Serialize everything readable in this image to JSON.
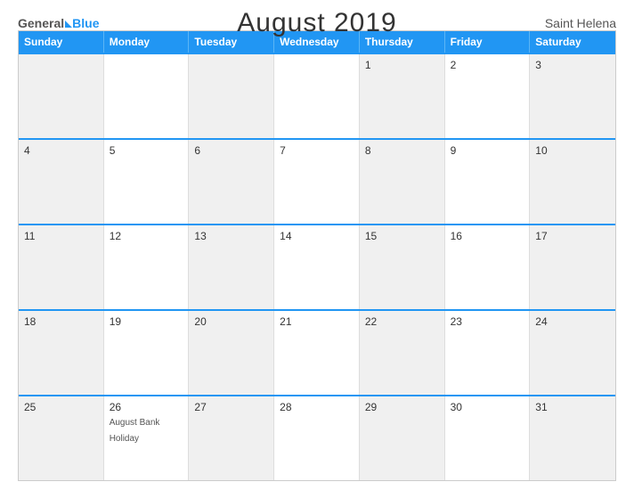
{
  "header": {
    "logo": {
      "general": "General",
      "blue": "Blue",
      "triangle": true
    },
    "title": "August 2019",
    "region": "Saint Helena"
  },
  "calendar": {
    "days_of_week": [
      "Sunday",
      "Monday",
      "Tuesday",
      "Wednesday",
      "Thursday",
      "Friday",
      "Saturday"
    ],
    "weeks": [
      [
        {
          "day": "",
          "shaded": true
        },
        {
          "day": "",
          "shaded": false
        },
        {
          "day": "",
          "shaded": true
        },
        {
          "day": "",
          "shaded": false
        },
        {
          "day": "1",
          "shaded": true
        },
        {
          "day": "2",
          "shaded": false
        },
        {
          "day": "3",
          "shaded": true
        }
      ],
      [
        {
          "day": "4",
          "shaded": true
        },
        {
          "day": "5",
          "shaded": false
        },
        {
          "day": "6",
          "shaded": true
        },
        {
          "day": "7",
          "shaded": false
        },
        {
          "day": "8",
          "shaded": true
        },
        {
          "day": "9",
          "shaded": false
        },
        {
          "day": "10",
          "shaded": true
        }
      ],
      [
        {
          "day": "11",
          "shaded": true
        },
        {
          "day": "12",
          "shaded": false
        },
        {
          "day": "13",
          "shaded": true
        },
        {
          "day": "14",
          "shaded": false
        },
        {
          "day": "15",
          "shaded": true
        },
        {
          "day": "16",
          "shaded": false
        },
        {
          "day": "17",
          "shaded": true
        }
      ],
      [
        {
          "day": "18",
          "shaded": true
        },
        {
          "day": "19",
          "shaded": false
        },
        {
          "day": "20",
          "shaded": true
        },
        {
          "day": "21",
          "shaded": false
        },
        {
          "day": "22",
          "shaded": true
        },
        {
          "day": "23",
          "shaded": false
        },
        {
          "day": "24",
          "shaded": true
        }
      ],
      [
        {
          "day": "25",
          "shaded": true
        },
        {
          "day": "26",
          "shaded": false,
          "event": "August Bank Holiday"
        },
        {
          "day": "27",
          "shaded": true
        },
        {
          "day": "28",
          "shaded": false
        },
        {
          "day": "29",
          "shaded": true
        },
        {
          "day": "30",
          "shaded": false
        },
        {
          "day": "31",
          "shaded": true
        }
      ]
    ]
  }
}
